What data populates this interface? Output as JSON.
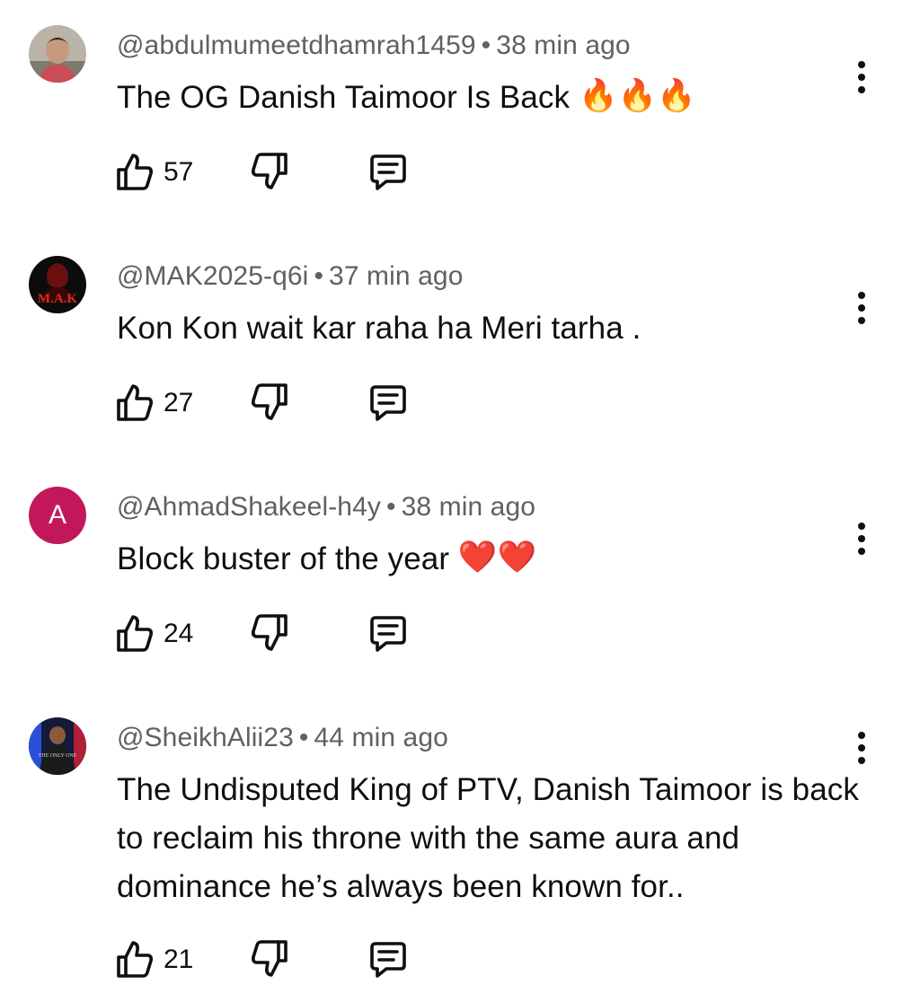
{
  "comments": [
    {
      "author": "@abdulmumeetdhamrah1459",
      "separator": "•",
      "time": "38 min ago",
      "text": "The OG Danish Taimoor Is Back",
      "emoji": [
        "🔥",
        "🔥",
        "🔥"
      ],
      "likes": "57",
      "avatar": "photo-avatar"
    },
    {
      "author": "@MAK2025-q6i",
      "separator": "•",
      "time": "37 min ago",
      "text": "Kon Kon wait kar raha ha Meri tarha .",
      "likes": "27",
      "avatar": "mak-logo-avatar",
      "avatar_label": "M.A.K"
    },
    {
      "author": "@AhmadShakeel-h4y",
      "separator": "•",
      "time": "38 min ago",
      "text": "Block buster of the year",
      "emoji": [
        "❤️",
        "❤️"
      ],
      "likes": "24",
      "avatar": "letter-avatar",
      "avatar_letter": "A"
    },
    {
      "author": "@SheikhAlii23",
      "separator": "•",
      "time": "44 min ago",
      "text": "The Undisputed King of PTV, Danish Taimoor is back to reclaim his throne with the same aura and dominance he’s always been known for..",
      "likes": "21",
      "avatar": "photo-avatar",
      "avatar_label": "THE ONLY ONE"
    }
  ],
  "colors": {
    "text": "#0f0f0f",
    "meta": "#606060",
    "letter_avatar_bg": "#c2185b"
  }
}
